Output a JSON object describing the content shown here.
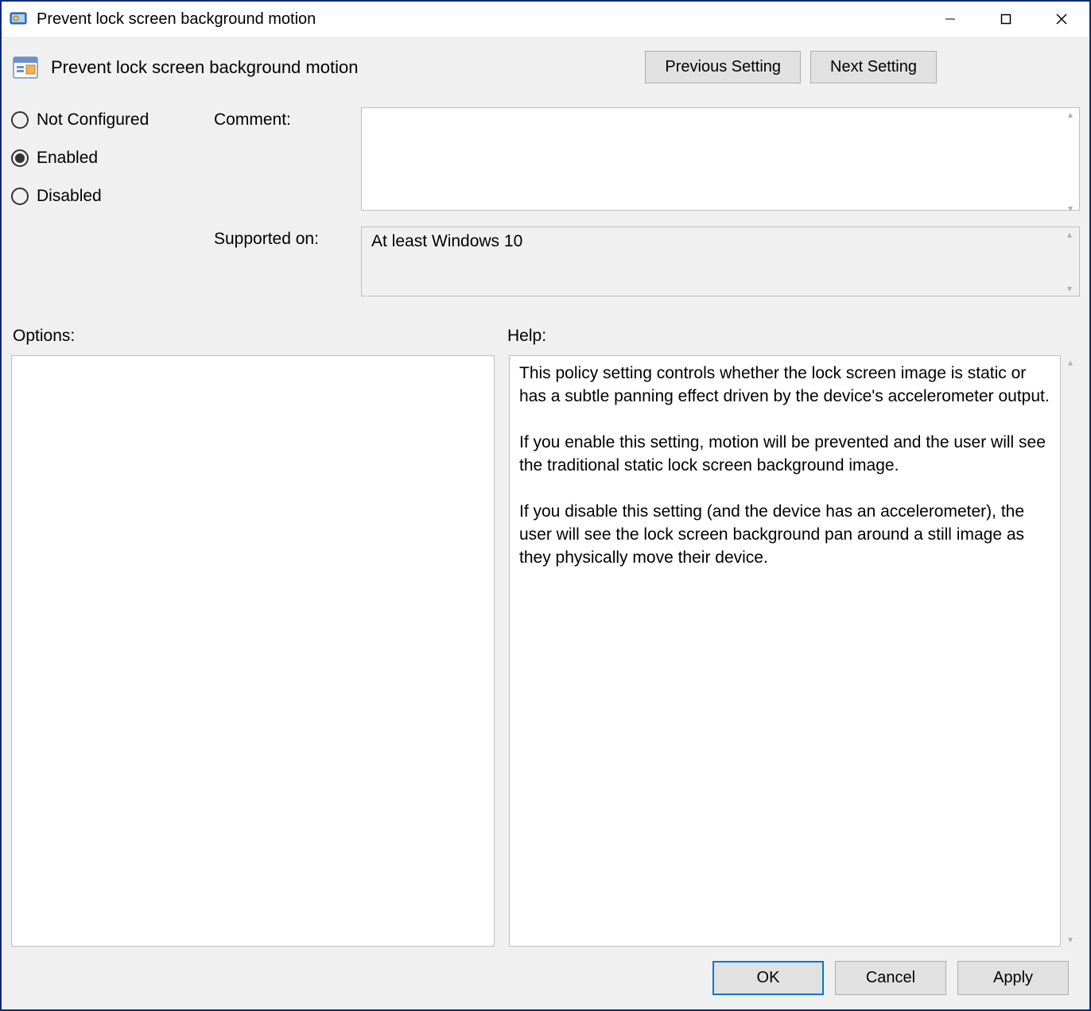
{
  "window": {
    "title": "Prevent lock screen background motion"
  },
  "policy": {
    "name": "Prevent lock screen background motion"
  },
  "nav": {
    "previous": "Previous Setting",
    "next": "Next Setting"
  },
  "state": {
    "options": [
      "Not Configured",
      "Enabled",
      "Disabled"
    ],
    "selected": "Enabled"
  },
  "labels": {
    "comment": "Comment:",
    "supported": "Supported on:",
    "options": "Options:",
    "help": "Help:"
  },
  "comment": "",
  "supported_on": "At least Windows 10",
  "help_text": "This policy setting controls whether the lock screen image is static or has a subtle panning effect driven by the device's accelerometer output.\n\nIf you enable this setting, motion will be prevented and the user will see the traditional static lock screen background image.\n\nIf you disable this setting (and the device has an accelerometer), the user will see the lock screen background pan around a still image as they physically move their device.",
  "footer": {
    "ok": "OK",
    "cancel": "Cancel",
    "apply": "Apply"
  }
}
